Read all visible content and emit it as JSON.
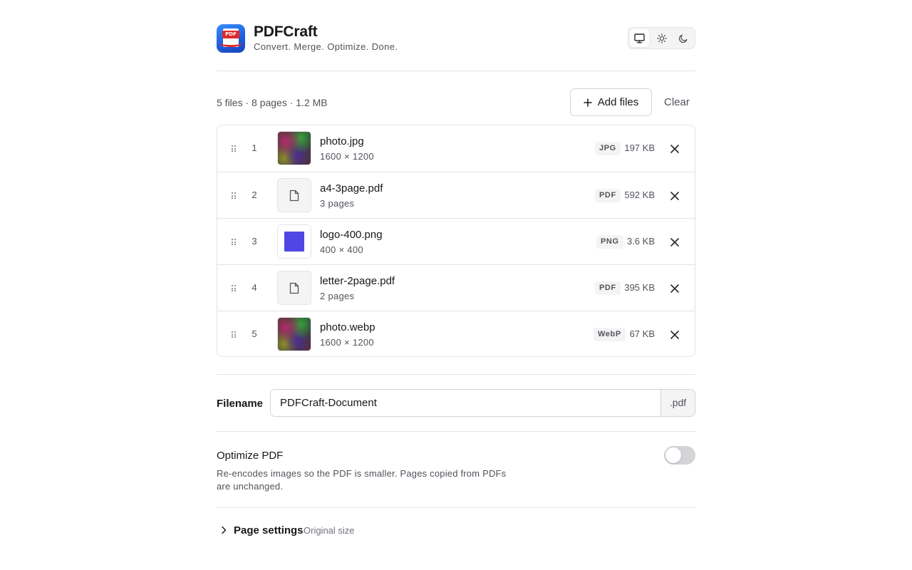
{
  "app": {
    "name": "PDFCraft",
    "tagline": "Convert. Merge. Optimize. Done.",
    "logo_badge": "PDF"
  },
  "theme": {
    "options": [
      "monitor-icon",
      "sun-icon",
      "moon-icon"
    ],
    "selected": "system"
  },
  "summary": {
    "text": "5 files · 8 pages · 1.2 MB",
    "add_label": "Add files",
    "clear_label": "Clear"
  },
  "files": [
    {
      "index": "1",
      "name": "photo.jpg",
      "meta": "1600 × 1200",
      "type": "JPG",
      "size": "197 KB",
      "thumb": "photo"
    },
    {
      "index": "2",
      "name": "a4-3page.pdf",
      "meta": "3 pages",
      "type": "PDF",
      "size": "592 KB",
      "thumb": "document-icon"
    },
    {
      "index": "3",
      "name": "logo-400.png",
      "meta": "400 × 400",
      "type": "PNG",
      "size": "3.6 KB",
      "thumb": "logo"
    },
    {
      "index": "4",
      "name": "letter-2page.pdf",
      "meta": "2 pages",
      "type": "PDF",
      "size": "395 KB",
      "thumb": "document-icon"
    },
    {
      "index": "5",
      "name": "photo.webp",
      "meta": "1600 × 1200",
      "type": "WebP",
      "size": "67 KB",
      "thumb": "photo"
    }
  ],
  "filename": {
    "label": "Filename",
    "value": "PDFCraft-Document",
    "extension": ".pdf"
  },
  "optimize": {
    "title": "Optimize PDF",
    "description": "Re-encodes images so the PDF is smaller. Pages copied from PDFs are unchanged.",
    "enabled": false
  },
  "page_settings": {
    "title": "Page settings",
    "value": "Original size"
  },
  "colors": {
    "accent": "#4f46e5",
    "border": "#e4e4e7",
    "muted_text": "#52525b"
  }
}
